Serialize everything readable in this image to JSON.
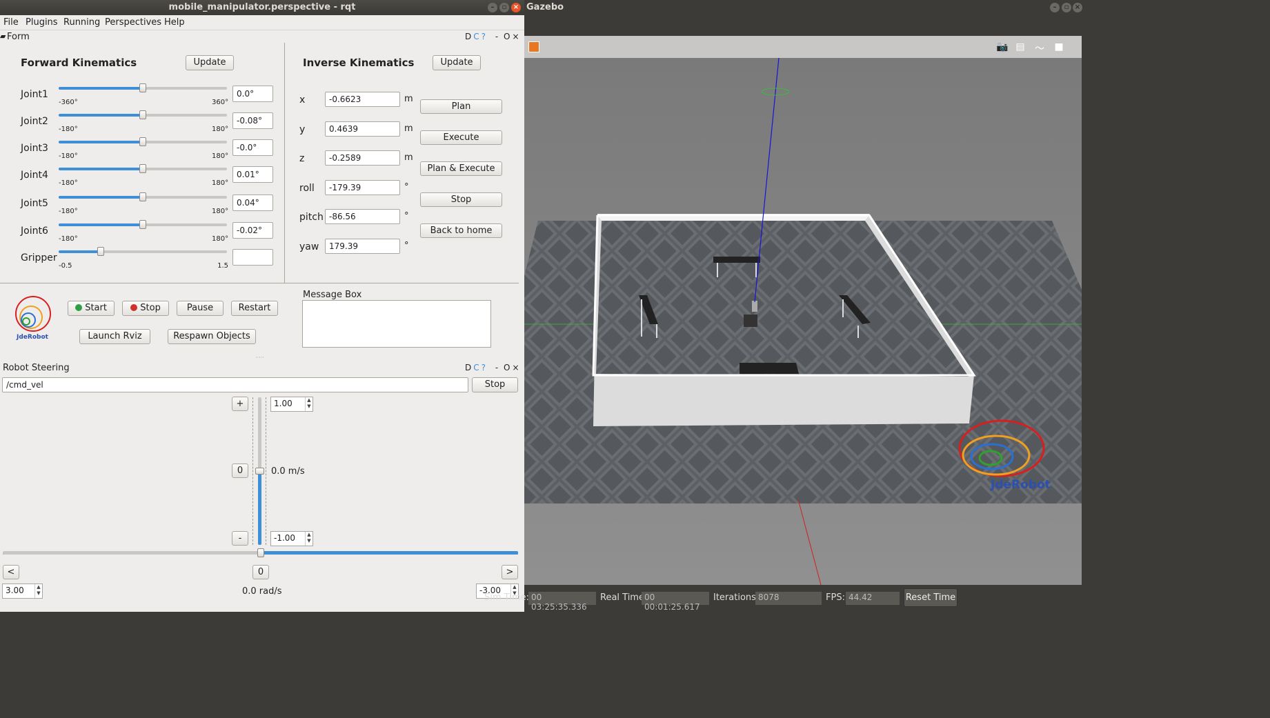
{
  "rqt": {
    "title": "mobile_manipulator.perspective - rqt",
    "menu": [
      "File",
      "Plugins",
      "Running",
      "Perspectives",
      "Help"
    ],
    "dock_controls": [
      "D",
      "C",
      "?",
      "-",
      "O",
      "×"
    ],
    "form": {
      "dock_title": "Form",
      "fk": {
        "title": "Forward Kinematics",
        "update_label": "Update",
        "joints": [
          {
            "name": "Joint1",
            "min": "-360°",
            "max": "360°",
            "value": "0.0°",
            "level": 0.5
          },
          {
            "name": "Joint2",
            "min": "-180°",
            "max": "180°",
            "value": "-0.08°",
            "level": 0.5
          },
          {
            "name": "Joint3",
            "min": "-180°",
            "max": "180°",
            "value": "-0.0°",
            "level": 0.5
          },
          {
            "name": "Joint4",
            "min": "-180°",
            "max": "180°",
            "value": "0.01°",
            "level": 0.5
          },
          {
            "name": "Joint5",
            "min": "-180°",
            "max": "180°",
            "value": "0.04°",
            "level": 0.5
          },
          {
            "name": "Joint6",
            "min": "-180°",
            "max": "180°",
            "value": "-0.02°",
            "level": 0.5
          },
          {
            "name": "Gripper",
            "min": "-0.5",
            "max": "1.5",
            "value": "",
            "level": 0.25
          }
        ]
      },
      "ik": {
        "title": "Inverse Kinematics",
        "update_label": "Update",
        "fields": [
          {
            "name": "x",
            "value": "-0.6623",
            "unit": "m"
          },
          {
            "name": "y",
            "value": "0.4639",
            "unit": "m"
          },
          {
            "name": "z",
            "value": "-0.2589",
            "unit": "m"
          },
          {
            "name": "roll",
            "value": "-179.39",
            "unit": "°"
          },
          {
            "name": "pitch",
            "value": "-86.56",
            "unit": "°"
          },
          {
            "name": "yaw",
            "value": "179.39",
            "unit": "°"
          }
        ],
        "buttons": [
          "Plan",
          "Execute",
          "Plan & Execute",
          "Stop",
          "Back to home"
        ]
      },
      "logo_text": "JdeRobot",
      "controls": {
        "start": "Start",
        "stop": "Stop",
        "pause": "Pause",
        "restart": "Restart",
        "launch_rviz": "Launch Rviz",
        "respawn": "Respawn Objects"
      },
      "message_box_label": "Message Box",
      "message_box_text": ""
    },
    "steering": {
      "dock_title": "Robot Steering",
      "topic": "/cmd_vel",
      "stop_label": "Stop",
      "plus_label": "+",
      "zero_label": "0",
      "minus_label": "-",
      "linear_max": "1.00",
      "linear_min": "-1.00",
      "linear_value": "0.0 m/s",
      "linear_level": 0.5,
      "left_label": "<",
      "center_label": "0",
      "right_label": ">",
      "angular_max": "3.00",
      "angular_min": "-3.00",
      "angular_value": "0.0 rad/s",
      "angular_level": 0.5
    }
  },
  "gazebo": {
    "title": "Gazebo",
    "status": {
      "sim_time_label": "Sim Time:",
      "sim_time": "00 03:25:35.336",
      "real_time_label": "Real Time:",
      "real_time": "00 00:01:25.617",
      "iterations_label": "Iterations:",
      "iterations": "8078",
      "fps_label": "FPS:",
      "fps": "44.42",
      "reset_label": "Reset Time"
    },
    "watermark": "JdeRobot"
  },
  "colors": {
    "accent": "#3f8fd8",
    "close": "#e9542a",
    "start_dot": "#2ea043",
    "stop_dot": "#d0312d"
  }
}
